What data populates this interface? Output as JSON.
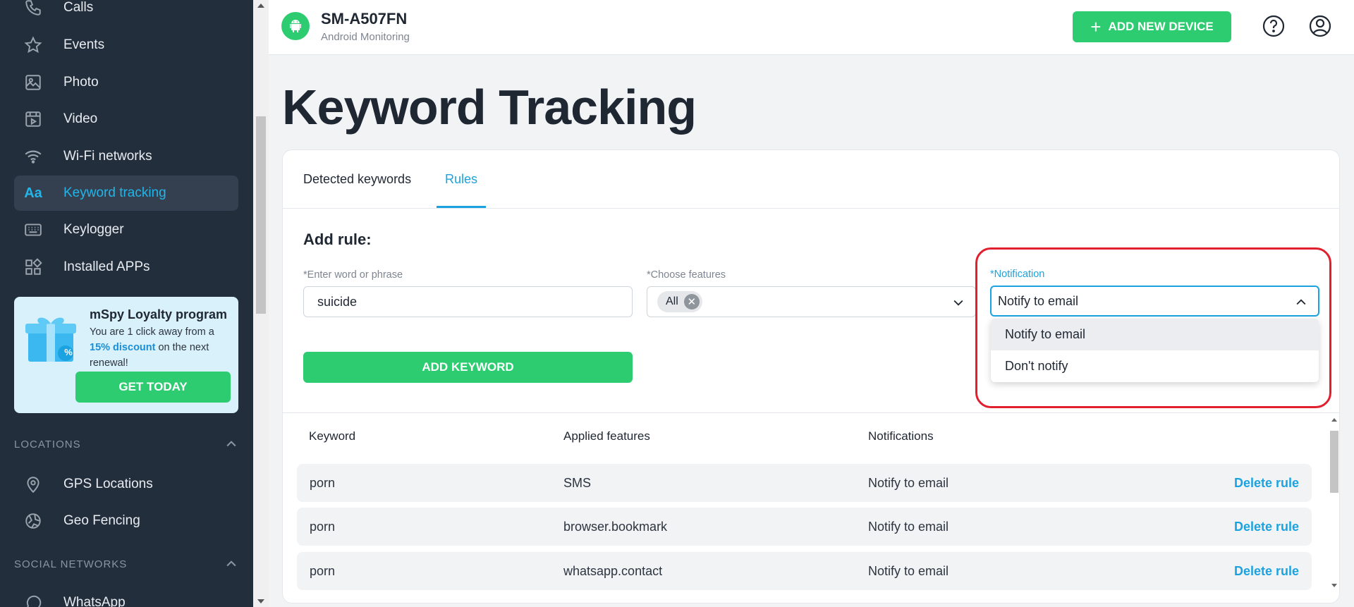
{
  "sidebar": {
    "items": [
      {
        "label": "Calls",
        "icon": "phone-icon"
      },
      {
        "label": "Events",
        "icon": "star-icon"
      },
      {
        "label": "Photo",
        "icon": "image-icon"
      },
      {
        "label": "Video",
        "icon": "video-icon"
      },
      {
        "label": "Wi-Fi networks",
        "icon": "wifi-icon"
      },
      {
        "label": "Keyword tracking",
        "icon": "keyword-icon",
        "glyph": "Aa",
        "active": true
      },
      {
        "label": "Keylogger",
        "icon": "keyboard-icon"
      },
      {
        "label": "Installed APPs",
        "icon": "apps-icon"
      }
    ],
    "promo": {
      "title": "mSpy Loyalty program",
      "body_before": "You are 1 click away from a ",
      "body_highlight": "15% discount",
      "body_after": " on the next renewal!",
      "button": "GET TODAY",
      "gift_badge": "%"
    },
    "locations": {
      "heading": "LOCATIONS",
      "items": [
        {
          "label": "GPS Locations",
          "icon": "location-pin-icon"
        },
        {
          "label": "Geo Fencing",
          "icon": "geo-fencing-icon"
        }
      ]
    },
    "social": {
      "heading": "SOCIAL NETWORKS",
      "items": [
        {
          "label": "WhatsApp",
          "icon": "whatsapp-icon"
        }
      ]
    }
  },
  "header": {
    "device_name": "SM-A507FN",
    "device_subtitle": "Android Monitoring",
    "add_button": "ADD NEW DEVICE",
    "add_plus": "+"
  },
  "page": {
    "title": "Keyword Tracking",
    "tabs": [
      {
        "label": "Detected keywords",
        "active": false
      },
      {
        "label": "Rules",
        "active": true
      }
    ],
    "add_rule": {
      "heading": "Add rule:",
      "word_label": "*Enter word or phrase",
      "word_value": "suicide",
      "features_label": "*Choose features",
      "features_chip": "All",
      "chip_remove": "✕",
      "notification_label": "*Notification",
      "notification_value": "Notify to email",
      "notification_options": [
        "Notify to email",
        "Don't notify"
      ],
      "add_button": "ADD KEYWORD"
    },
    "table": {
      "headers": [
        "Keyword",
        "Applied features",
        "Notifications"
      ],
      "rows": [
        {
          "keyword": "porn",
          "features": "SMS",
          "notification": "Notify to email",
          "action": "Delete rule"
        },
        {
          "keyword": "porn",
          "features": "browser.bookmark",
          "notification": "Notify to email",
          "action": "Delete rule"
        },
        {
          "keyword": "porn",
          "features": "whatsapp.contact",
          "notification": "Notify to email",
          "action": "Delete rule"
        }
      ]
    }
  },
  "colors": {
    "sidebar_bg": "#232e3c",
    "accent_blue": "#1aa3e0",
    "green": "#2ecc71",
    "highlight_red": "#e0202f"
  }
}
